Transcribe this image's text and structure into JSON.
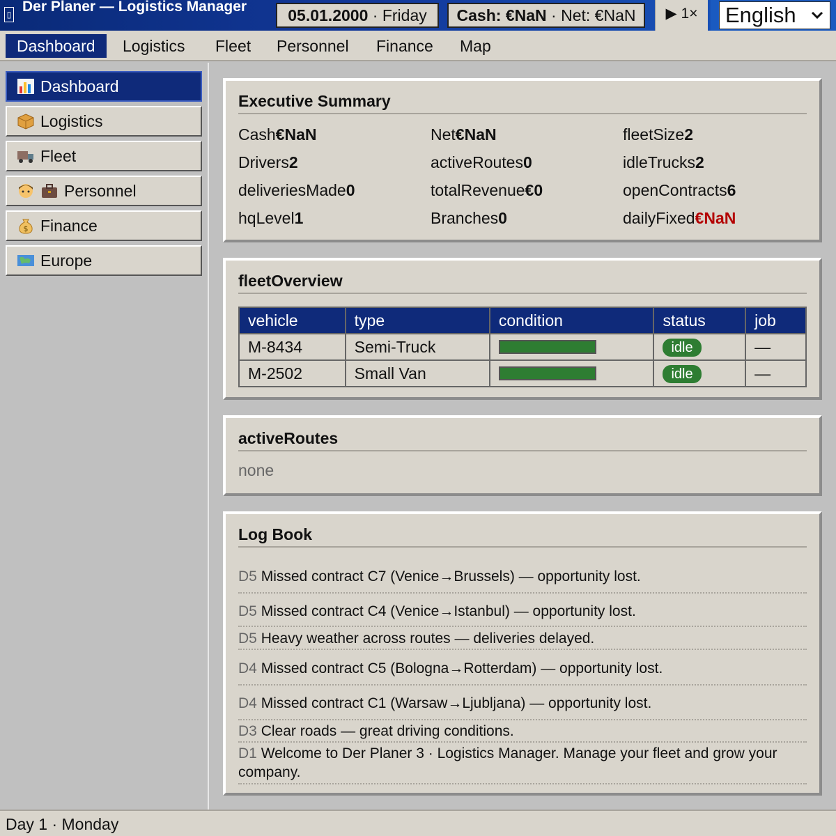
{
  "app": {
    "title": "Der Planer — Logistics Manager",
    "date_label": "05.01.2000",
    "weekday": "Friday",
    "cash_label": "Cash: €NaN",
    "net_label": "Net: €NaN",
    "speed_label": "▶ 1×",
    "language": "English"
  },
  "menu": {
    "items": [
      "Dashboard",
      "Logistics",
      "Fleet",
      "Personnel",
      "Finance",
      "Map"
    ],
    "active": "Dashboard"
  },
  "sidebar": {
    "items": [
      {
        "label": "Dashboard",
        "icon": "chart-icon"
      },
      {
        "label": "Logistics",
        "icon": "package-icon"
      },
      {
        "label": "Fleet",
        "icon": "truck-icon"
      },
      {
        "label": "Personnel",
        "icon": "person-briefcase-icon"
      },
      {
        "label": "Finance",
        "icon": "money-bag-icon"
      },
      {
        "label": "Europe",
        "icon": "map-icon"
      }
    ]
  },
  "summary": {
    "title": "Executive Summary",
    "stats": [
      {
        "label": "Cash",
        "value": "€NaN"
      },
      {
        "label": "Net",
        "value": "€NaN"
      },
      {
        "label": "fleetSize",
        "value": "2"
      },
      {
        "label": "Drivers",
        "value": "2"
      },
      {
        "label": "activeRoutes",
        "value": "0"
      },
      {
        "label": "idleTrucks",
        "value": "2"
      },
      {
        "label": "deliveriesMade",
        "value": "0"
      },
      {
        "label": "totalRevenue",
        "value": "€0"
      },
      {
        "label": "openContracts",
        "value": "6"
      },
      {
        "label": "hqLevel",
        "value": "1"
      },
      {
        "label": "Branches",
        "value": "0"
      },
      {
        "label": "dailyFixed",
        "value": "€NaN"
      }
    ]
  },
  "fleet": {
    "title": "fleetOverview",
    "columns": [
      "vehicle",
      "type",
      "condition",
      "status",
      "job"
    ],
    "rows": [
      {
        "vehicle": "M-8434",
        "type": "Semi-Truck",
        "condition": 1.0,
        "status": "idle",
        "job": "—"
      },
      {
        "vehicle": "M-2502",
        "type": "Small Van",
        "condition": 1.0,
        "status": "idle",
        "job": "—"
      }
    ]
  },
  "routes": {
    "title": "activeRoutes",
    "empty": "none"
  },
  "log": {
    "title": "Log Book",
    "entries": [
      {
        "day": "D5",
        "text": "Missed contract C7 (Venice→Brussels) — opportunity lost."
      },
      {
        "day": "D5",
        "text": "Missed contract C4 (Venice→Istanbul) — opportunity lost."
      },
      {
        "day": "D5",
        "text": "Heavy weather across routes — deliveries delayed."
      },
      {
        "day": "D4",
        "text": "Missed contract C5 (Bologna→Rotterdam) — opportunity lost."
      },
      {
        "day": "D4",
        "text": "Missed contract C1 (Warsaw→Ljubljana) — opportunity lost."
      },
      {
        "day": "D3",
        "text": "Clear roads — great driving conditions."
      },
      {
        "day": "D1",
        "text": "Welcome to Der Planer 3 · Logistics Manager. Manage your fleet and grow your company."
      }
    ]
  },
  "statusbar": {
    "text": "Day 1 · Monday"
  },
  "colors": {
    "titlebar": "#0a2a78",
    "active": "#0f2a7a",
    "panel": "#d9d5cc",
    "good": "#2e7d32",
    "negative": "#b30000"
  }
}
